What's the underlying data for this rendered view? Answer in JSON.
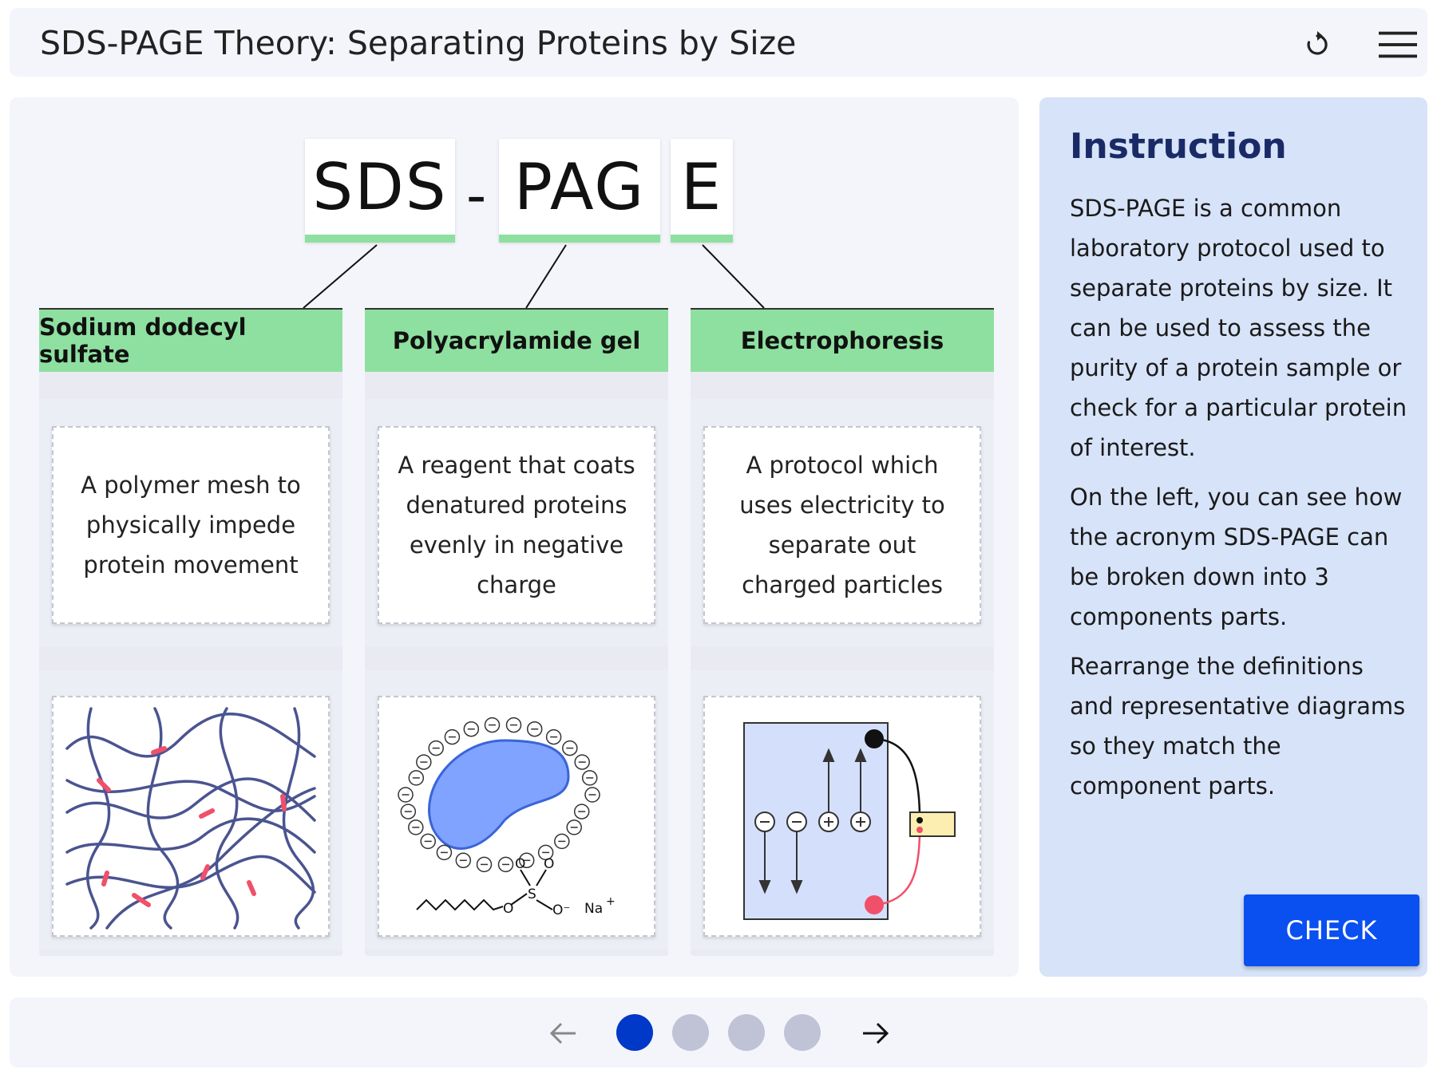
{
  "header": {
    "title": "SDS-PAGE Theory: Separating Proteins by Size"
  },
  "acronym": {
    "parts": [
      "SDS",
      "-",
      "PAG",
      "E"
    ]
  },
  "columns": [
    {
      "header": "Sodium dodecyl sulfate",
      "definition": "A polymer mesh to physically impede protein movement",
      "diagram": "polymer-mesh-diagram"
    },
    {
      "header": "Polyacrylamide gel",
      "definition": "A reagent that coats denatured proteins evenly in negative charge",
      "diagram": "sds-coated-protein-diagram"
    },
    {
      "header": "Electrophoresis",
      "definition": "A protocol which uses electricity to separate out charged particles",
      "diagram": "electrophoresis-circuit-diagram"
    }
  ],
  "diagram_labels": {
    "sodium": "Na",
    "sodium_charge": "+",
    "sulfur": "S",
    "oxygen": "O",
    "oxygen_minus": "O⁻"
  },
  "instruction": {
    "title": "Instruction",
    "paragraphs": [
      "SDS-PAGE is a common laboratory protocol used to separate proteins by size. It can be used to assess the purity of a protein sample or check for a particular protein of interest.",
      "On the left, you can see how the acronym SDS-PAGE can be broken down into 3 components parts.",
      "Rearrange the definitions and representative diagrams so they match the component parts."
    ],
    "check_label": "CHECK"
  },
  "pagination": {
    "total": 4,
    "current": 1
  },
  "colors": {
    "accent_green": "#8ee0a0",
    "primary_blue": "#0a4ff0",
    "active_dot": "#0038c8",
    "inactive_dot": "#c0c3d6",
    "instruction_bg": "#d7e3f8"
  }
}
